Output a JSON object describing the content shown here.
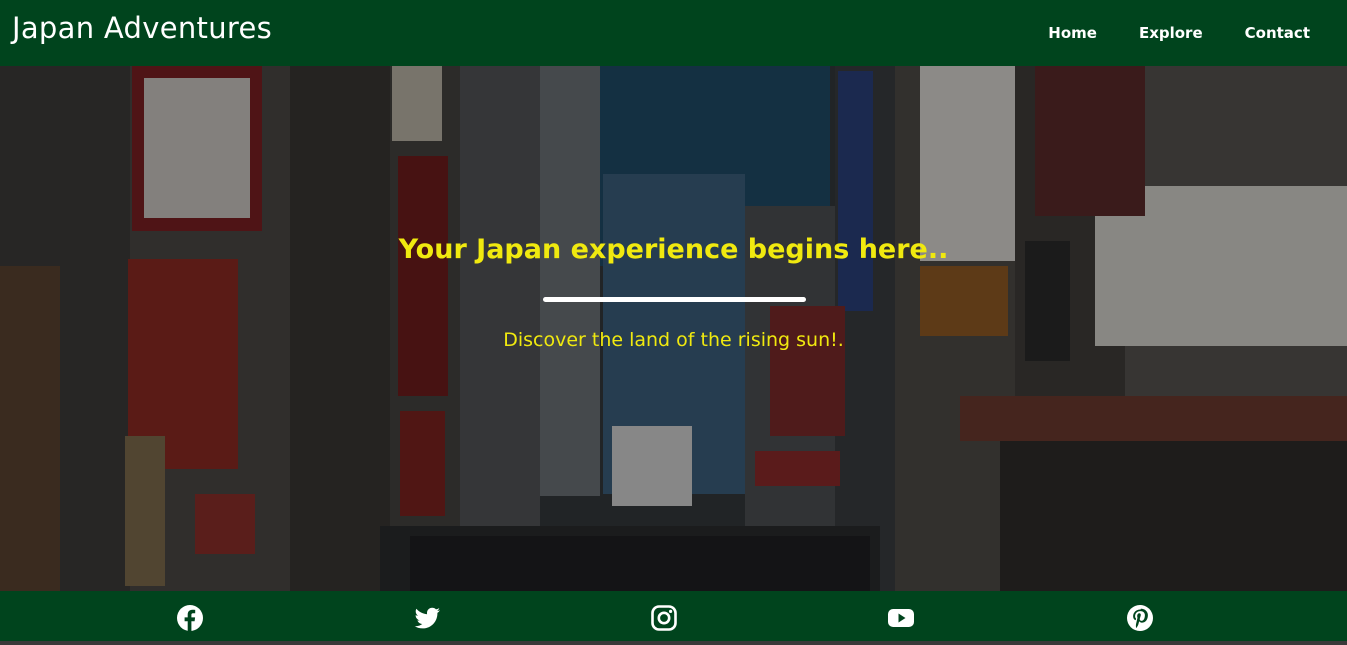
{
  "header": {
    "brand": "Japan Adventures",
    "nav": [
      {
        "label": "Home"
      },
      {
        "label": "Explore"
      },
      {
        "label": "Contact"
      }
    ]
  },
  "hero": {
    "title": "Your Japan experience begins here..",
    "subtitle": "Discover the land of the rising sun!."
  },
  "footer": {
    "social_icons": [
      "facebook-icon",
      "twitter-icon",
      "instagram-icon",
      "youtube-icon",
      "pinterest-icon"
    ]
  },
  "colors": {
    "brand_green": "#00441d",
    "accent_yellow": "#f0e90f",
    "white": "#ffffff"
  }
}
